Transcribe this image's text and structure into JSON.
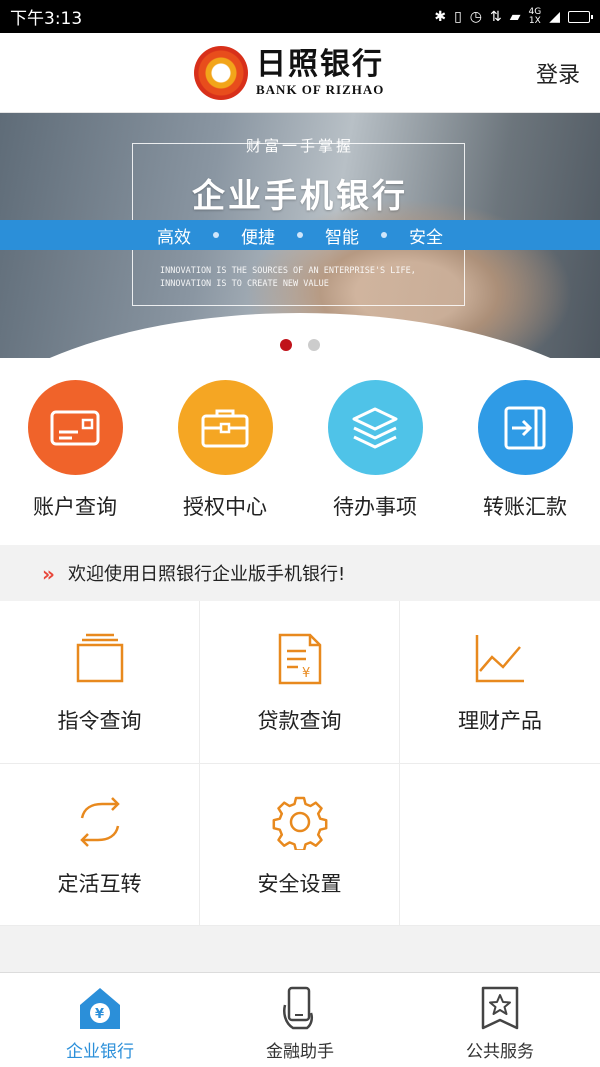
{
  "status_bar": {
    "time": "下午3:13",
    "network": "4G",
    "network_sub": "1X"
  },
  "header": {
    "bank_name_cn": "日照银行",
    "bank_name_en": "BANK OF RIZHAO",
    "login_label": "登录"
  },
  "banner": {
    "subtitle": "财富一手掌握",
    "title": "企业手机银行",
    "features": [
      "高效",
      "便捷",
      "智能",
      "安全"
    ],
    "english_line_1": "INNOVATION IS THE SOURCES OF AN ENTERPRISE'S LIFE,",
    "english_line_2": "INNOVATION IS TO CREATE NEW VALUE"
  },
  "quick_actions": [
    {
      "label": "账户查询",
      "icon": "card-icon",
      "color": "#f0632a"
    },
    {
      "label": "授权中心",
      "icon": "briefcase-icon",
      "color": "#f5a623"
    },
    {
      "label": "待办事项",
      "icon": "layers-icon",
      "color": "#4fc3e8"
    },
    {
      "label": "转账汇款",
      "icon": "transfer-icon",
      "color": "#2f9be6"
    }
  ],
  "notice": {
    "text": "欢迎使用日照银行企业版手机银行!"
  },
  "grid": [
    {
      "label": "指令查询",
      "icon": "folder-icon"
    },
    {
      "label": "贷款查询",
      "icon": "loan-document-icon"
    },
    {
      "label": "理财产品",
      "icon": "chart-line-icon"
    },
    {
      "label": "定活互转",
      "icon": "exchange-icon"
    },
    {
      "label": "安全设置",
      "icon": "gear-icon"
    }
  ],
  "icon_color": "#e8891e",
  "tabs": [
    {
      "label": "企业银行",
      "icon": "home-yuan-icon",
      "active": true
    },
    {
      "label": "金融助手",
      "icon": "phone-hand-icon",
      "active": false
    },
    {
      "label": "公共服务",
      "icon": "star-bookmark-icon",
      "active": false
    }
  ],
  "accent_color": "#2b8fd9"
}
